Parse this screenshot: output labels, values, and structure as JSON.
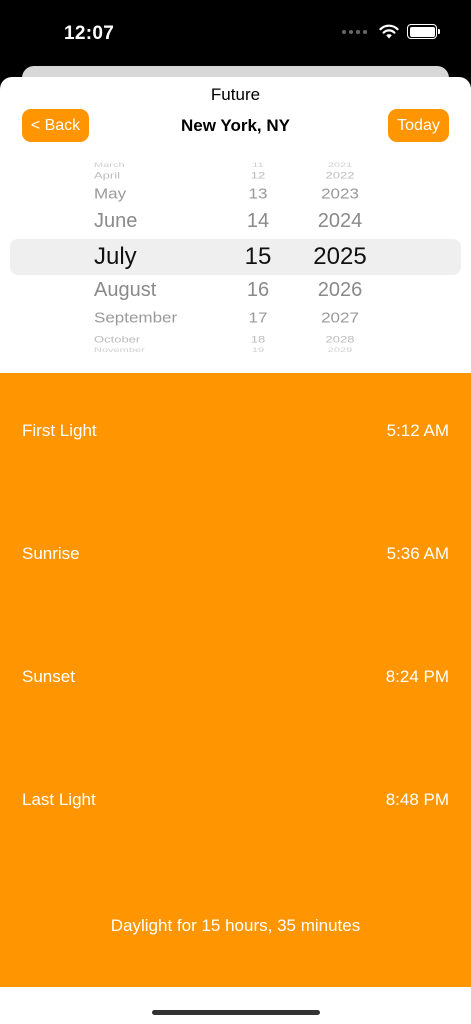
{
  "status_bar": {
    "time": "12:07"
  },
  "nav": {
    "title": "Future",
    "location": "New York, NY",
    "back_label": "< Back",
    "today_label": "Today"
  },
  "picker": {
    "months": [
      "March",
      "April",
      "May",
      "June",
      "July",
      "August",
      "September",
      "October",
      "November"
    ],
    "days": [
      "11",
      "12",
      "13",
      "14",
      "15",
      "16",
      "17",
      "18",
      "19"
    ],
    "years": [
      "2021",
      "2022",
      "2023",
      "2024",
      "2025",
      "2026",
      "2027",
      "2028",
      "2029"
    ],
    "selected": {
      "month": "July",
      "day": "15",
      "year": "2025"
    }
  },
  "sun_times": [
    {
      "label": "First Light",
      "time": "5:12 AM"
    },
    {
      "label": "Sunrise",
      "time": "5:36 AM"
    },
    {
      "label": "Sunset",
      "time": "8:24 PM"
    },
    {
      "label": "Last Light",
      "time": "8:48 PM"
    }
  ],
  "daylight_summary": "Daylight for 15 hours, 35 minutes",
  "colors": {
    "accent": "#ff9500",
    "background": "#ffffff",
    "status_bar": "#000000"
  }
}
